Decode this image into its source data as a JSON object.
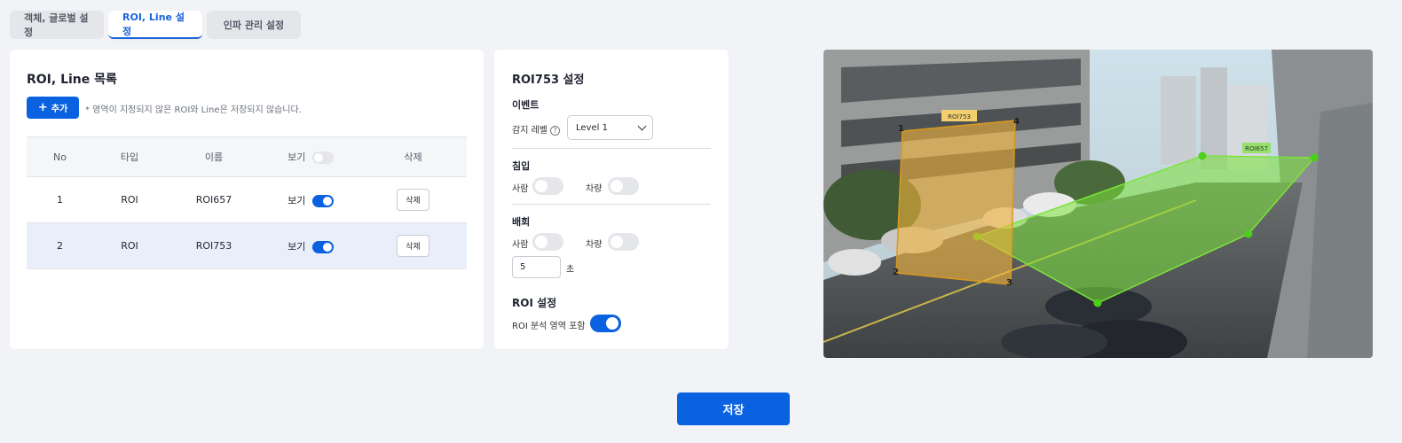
{
  "tabs": [
    {
      "label": "객체, 글로벌 설정"
    },
    {
      "label": "ROI, Line 설정"
    },
    {
      "label": "인파 관리 설정"
    }
  ],
  "list": {
    "title": "ROI, Line 목록",
    "add_label": "추가",
    "hint": "* 영역이 지정되지 않은 ROI와 Line은 저장되지 않습니다.",
    "headers": {
      "no": "No",
      "type": "타입",
      "name": "이름",
      "view": "보기",
      "delete": "삭제"
    },
    "rows": [
      {
        "no": "1",
        "type": "ROI",
        "name": "ROI657",
        "view": "보기",
        "delete": "삭제"
      },
      {
        "no": "2",
        "type": "ROI",
        "name": "ROI753",
        "view": "보기",
        "delete": "삭제"
      }
    ]
  },
  "settings": {
    "title": "ROI753 설정",
    "event_label": "이벤트",
    "sensitivity_label": "감지 레벨",
    "sensitivity_value": "Level 1",
    "intrusion_label": "침입",
    "loitering_label": "배회",
    "person_label": "사람",
    "vehicle_label": "차량",
    "loiter_seconds": "5",
    "seconds_unit": "초",
    "roi_section": "ROI 설정",
    "roi_include_label": "ROI 분석 영역 포함"
  },
  "camera": {
    "roi_753_label": "ROI753",
    "roi_657_label": "ROI657",
    "corners": [
      "1",
      "2",
      "3",
      "4"
    ]
  },
  "save_label": "저장",
  "colors": {
    "accent": "#0b62e0",
    "roi753": "#f3b43a",
    "roi657": "#7be33b"
  }
}
